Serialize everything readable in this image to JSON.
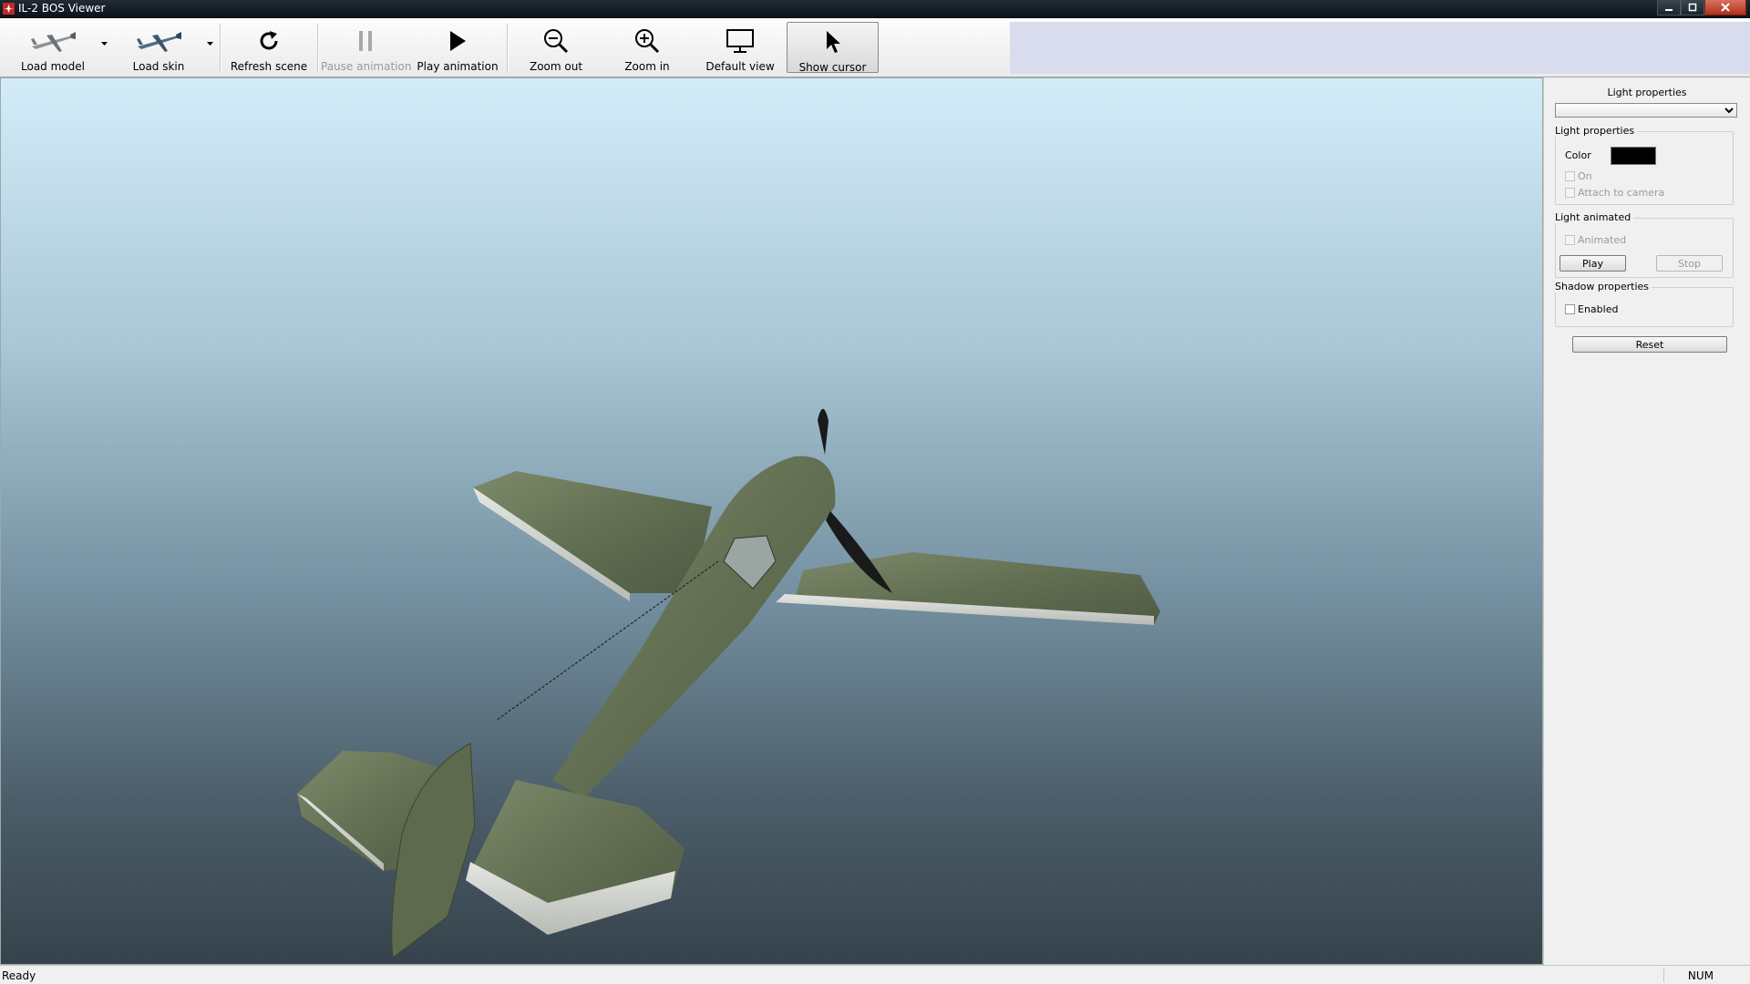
{
  "window": {
    "title": "IL-2 BOS Viewer",
    "controls": [
      "minimize-icon",
      "maximize-icon",
      "close-icon"
    ]
  },
  "toolbar": {
    "load_model": "Load model",
    "load_skin": "Load skin",
    "refresh_scene": "Refresh scene",
    "pause_animation": "Pause animation",
    "play_animation": "Play animation",
    "zoom_out": "Zoom out",
    "zoom_in": "Zoom in",
    "default_view": "Default view",
    "show_cursor": "Show cursor"
  },
  "panel": {
    "title": "Light properties",
    "dropdown_value": "",
    "light_group": {
      "label": "Light properties",
      "color_label": "Color",
      "color_value": "#000000",
      "on_label": "On",
      "on_checked": false,
      "attach_label": "Attach to camera",
      "attach_checked": false
    },
    "animated_group": {
      "label": "Light animated",
      "animated_label": "Animated",
      "animated_checked": false,
      "play": "Play",
      "stop": "Stop"
    },
    "shadow_group": {
      "label": "Shadow properties",
      "enabled_label": "Enabled",
      "enabled_checked": false
    },
    "reset": "Reset"
  },
  "status": {
    "text": "Ready",
    "num": "NUM"
  },
  "colors": {
    "sky_top": "#d4ecf9",
    "sky_bottom": "#36434c",
    "aircraft_camo": "#6d7a5c",
    "wing_underside": "#d7d9d3"
  }
}
